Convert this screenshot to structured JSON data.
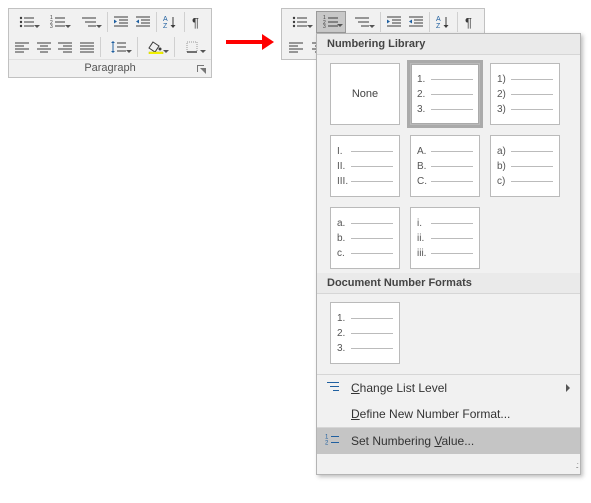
{
  "ribbon": {
    "group_label": "Paragraph"
  },
  "panel": {
    "library_header": "Numbering Library",
    "none_label": "None",
    "tiles": [
      {
        "style": "none"
      },
      {
        "style": "decimal-dot",
        "preview": [
          "1.",
          "2.",
          "3."
        ],
        "selected": true
      },
      {
        "style": "decimal-paren",
        "preview": [
          "1)",
          "2)",
          "3)"
        ]
      },
      {
        "style": "upper-roman",
        "preview": [
          "I.",
          "II.",
          "III."
        ]
      },
      {
        "style": "upper-alpha",
        "preview": [
          "A.",
          "B.",
          "C."
        ]
      },
      {
        "style": "lower-alpha-paren",
        "preview": [
          "a)",
          "b)",
          "c)"
        ]
      },
      {
        "style": "lower-alpha-dot",
        "preview": [
          "a.",
          "b.",
          "c."
        ]
      },
      {
        "style": "lower-roman",
        "preview": [
          "i.",
          "ii.",
          "iii."
        ]
      }
    ],
    "doc_header": "Document Number Formats",
    "doc_tiles": [
      {
        "style": "decimal-dot",
        "preview": [
          "1.",
          "2.",
          "3."
        ]
      }
    ],
    "menu": {
      "change_level": "Change List Level",
      "define_new": "Define New Number Format...",
      "set_value": "Set Numbering Value..."
    }
  }
}
